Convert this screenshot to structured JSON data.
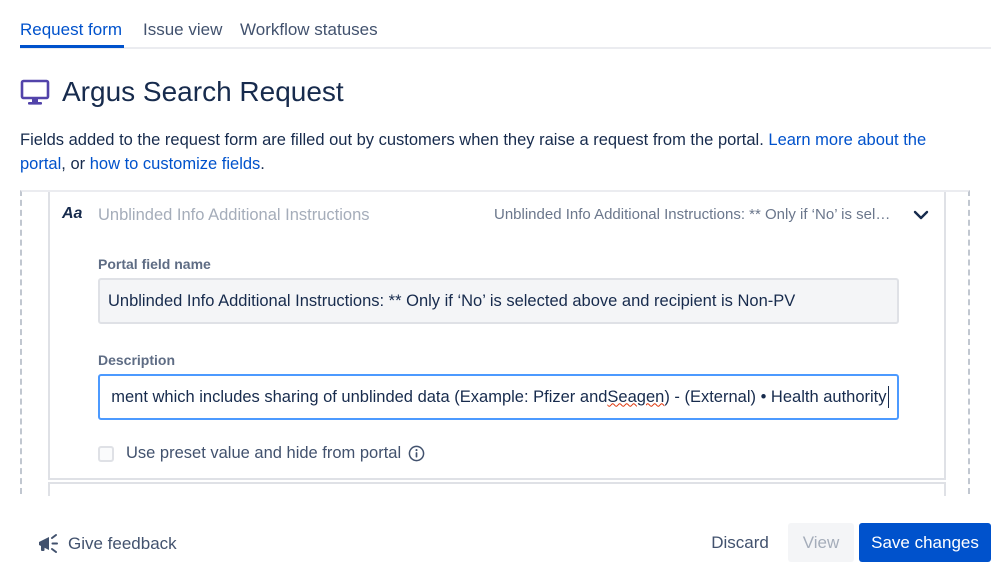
{
  "tabs": [
    {
      "label": "Request form",
      "active": true
    },
    {
      "label": "Issue view",
      "active": false
    },
    {
      "label": "Workflow statuses",
      "active": false
    }
  ],
  "header": {
    "icon": "monitor-icon",
    "title": "Argus Search Request"
  },
  "intro": {
    "text_before": "Fields added to the request form are filled out by customers when they raise a request from the portal. ",
    "link1": "Learn more about the portal",
    "text_middle": ", or ",
    "link2": "how to customize fields",
    "text_after": "."
  },
  "field_card": {
    "type_icon": "Aa",
    "title": "Unblinded Info Additional Instructions",
    "summary": "Unblinded Info Additional Instructions: ** Only if ‘No’ is selected above and recipient is Non-PV",
    "portal_field_label": "Portal field name",
    "portal_field_value": "Unblinded Info Additional Instructions: ** Only if ‘No’ is selected above and recipient is Non-PV",
    "description_label": "Description",
    "description_value_before": "ment which includes sharing of unblinded data (Example: Pfizer and ",
    "description_value_misspelled": "Seagen",
    "description_value_after": ") - (External) • Health authority",
    "preset_checkbox_label": "Use preset value and hide from portal",
    "preset_checked": false
  },
  "footer": {
    "feedback_label": "Give feedback",
    "discard_label": "Discard",
    "view_label": "View",
    "save_label": "Save changes"
  },
  "colors": {
    "accent": "#0052cc",
    "focus_border": "#4c9aff",
    "text": "#172b4d",
    "muted": "#6b778c",
    "icon_purple": "#5243aa"
  }
}
